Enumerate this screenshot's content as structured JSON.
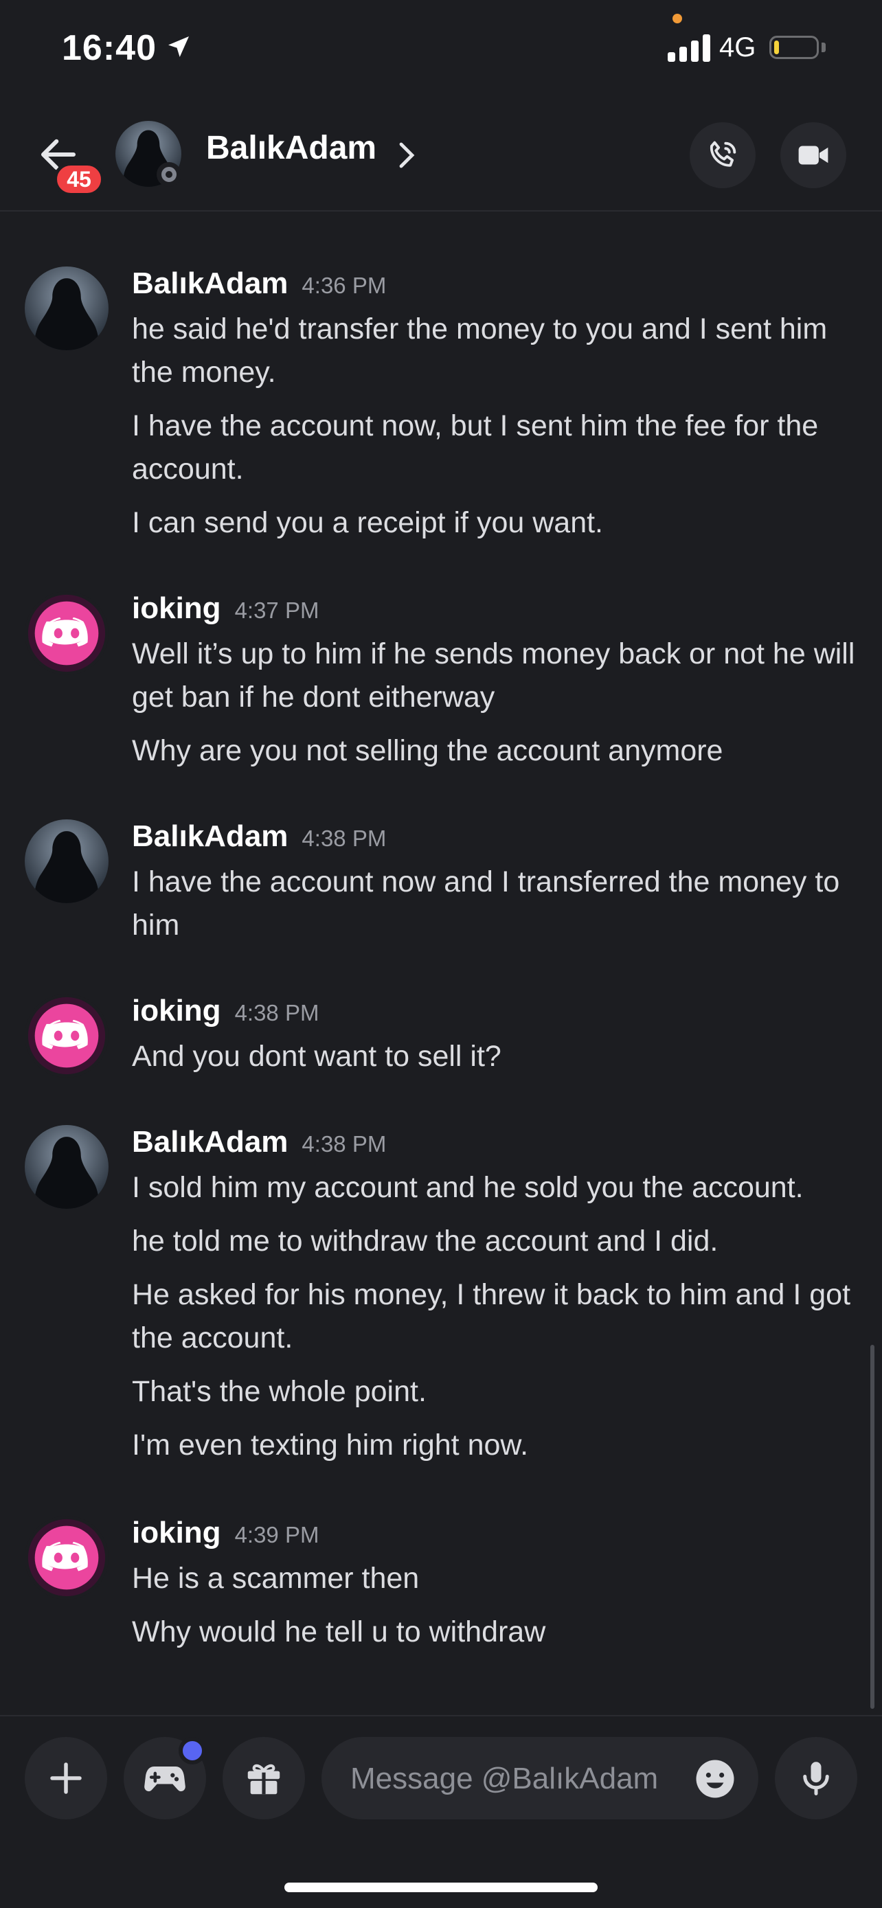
{
  "status_bar": {
    "time": "16:40",
    "network": "4G",
    "battery_level": 0.12
  },
  "header": {
    "name": "BalıkAdam",
    "unread_badge": "45"
  },
  "messages": [
    {
      "author": "",
      "timestamp": "",
      "lines": []
    },
    {
      "author": "BalıkAdam",
      "timestamp": "4:36 PM",
      "avatar": "hooded-figure",
      "lines": [
        "he said he'd transfer the money to you and I sent him the money.",
        "I have the account now, but I sent him the fee for the account.",
        "I can send you a receipt if you want."
      ]
    },
    {
      "author": "ioking",
      "timestamp": "4:37 PM",
      "avatar": "discord-logo-pink",
      "lines": [
        "Well it’s up to him if he sends money back or not he will get ban if he dont eitherway",
        "Why are you not selling the account anymore"
      ]
    },
    {
      "author": "BalıkAdam",
      "timestamp": "4:38 PM",
      "avatar": "hooded-figure",
      "lines": [
        "I have the account now and I transferred the money to him"
      ]
    },
    {
      "author": "ioking",
      "timestamp": "4:38 PM",
      "avatar": "discord-logo-pink",
      "lines": [
        "And you dont want to sell it?"
      ]
    },
    {
      "author": "BalıkAdam",
      "timestamp": "4:38 PM",
      "avatar": "hooded-figure",
      "lines": [
        "I sold him my account and he sold you the account.",
        "he told me to withdraw the account and I did.",
        "He asked for his money, I threw it back to him and I got the account.",
        "That's the whole point.",
        "I'm even texting him right now."
      ]
    },
    {
      "author": "ioking",
      "timestamp": "4:39 PM",
      "avatar": "discord-logo-pink",
      "lines": [
        "He is a scammer then",
        "Why would he tell u to withdraw"
      ]
    }
  ],
  "composer": {
    "placeholder": "Message @BalıkAdam"
  },
  "colors": {
    "background": "#1c1d21",
    "surface": "#27282d",
    "badge": "#ef3f42",
    "discord_pink": "#eb459e",
    "blurple": "#5865f2"
  }
}
